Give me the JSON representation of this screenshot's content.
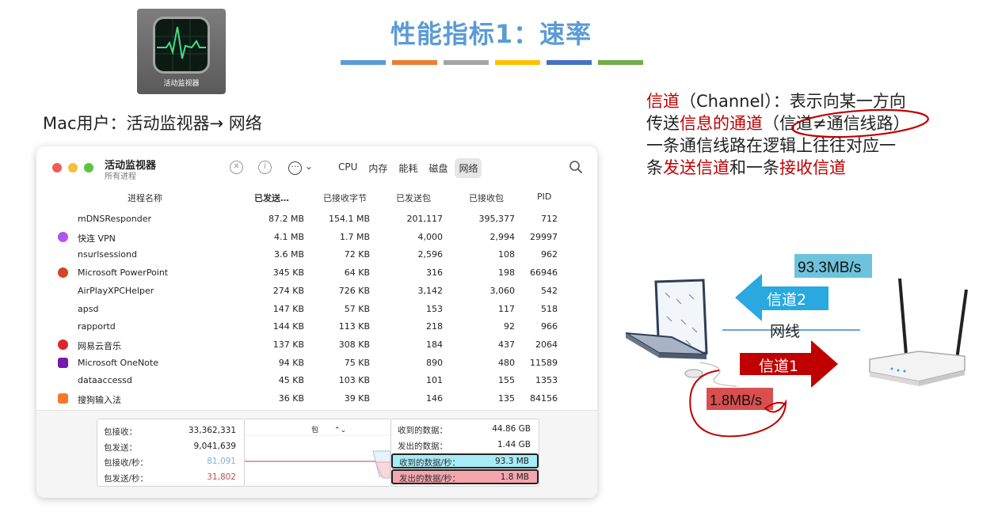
{
  "title": "性能指标1：速率",
  "title_bar_colors": [
    "#5b9bd5",
    "#ed7d31",
    "#a5a5a5",
    "#ffc000",
    "#4472c4",
    "#70ad47"
  ],
  "app_icon_label": "活动监视器",
  "mac_path": "Mac用户：活动监视器→ 网络",
  "window": {
    "title": "活动监视器",
    "subtitle": "所有进程",
    "tabs": [
      "CPU",
      "内存",
      "能耗",
      "磁盘",
      "网络"
    ],
    "active_tab": "网络",
    "columns": [
      "进程名称",
      "已发送…",
      "已接收字节",
      "已发送包",
      "已接收包",
      "PID"
    ],
    "rows": [
      {
        "name": "mDNSResponder",
        "sent": "87.2 MB",
        "recv": "154.1 MB",
        "pkt_sent": "201,117",
        "pkt_recv": "395,377",
        "pid": "712",
        "icon": "none"
      },
      {
        "name": "快连 VPN",
        "sent": "4.1 MB",
        "recv": "1.7 MB",
        "pkt_sent": "4,000",
        "pkt_recv": "2,994",
        "pid": "29997",
        "icon": "vpn-icon"
      },
      {
        "name": "nsurlsessiond",
        "sent": "3.6 MB",
        "recv": "72 KB",
        "pkt_sent": "2,596",
        "pkt_recv": "108",
        "pid": "962",
        "icon": "none"
      },
      {
        "name": "Microsoft PowerPoint",
        "sent": "345 KB",
        "recv": "64 KB",
        "pkt_sent": "316",
        "pkt_recv": "198",
        "pid": "66946",
        "icon": "powerpoint-icon"
      },
      {
        "name": "AirPlayXPCHelper",
        "sent": "274 KB",
        "recv": "726 KB",
        "pkt_sent": "3,142",
        "pkt_recv": "3,060",
        "pid": "542",
        "icon": "none"
      },
      {
        "name": "apsd",
        "sent": "147 KB",
        "recv": "57 KB",
        "pkt_sent": "153",
        "pkt_recv": "117",
        "pid": "518",
        "icon": "none"
      },
      {
        "name": "rapportd",
        "sent": "144 KB",
        "recv": "113 KB",
        "pkt_sent": "218",
        "pkt_recv": "92",
        "pid": "966",
        "icon": "none"
      },
      {
        "name": "网易云音乐",
        "sent": "137 KB",
        "recv": "308 KB",
        "pkt_sent": "184",
        "pkt_recv": "437",
        "pid": "2064",
        "icon": "netease-music-icon"
      },
      {
        "name": "Microsoft OneNote",
        "sent": "94 KB",
        "recv": "75 KB",
        "pkt_sent": "890",
        "pkt_recv": "480",
        "pid": "11589",
        "icon": "onenote-icon"
      },
      {
        "name": "dataaccessd",
        "sent": "45 KB",
        "recv": "103 KB",
        "pkt_sent": "101",
        "pkt_recv": "155",
        "pid": "1353",
        "icon": "none"
      },
      {
        "name": "搜狗输入法",
        "sent": "36 KB",
        "recv": "39 KB",
        "pkt_sent": "146",
        "pkt_recv": "135",
        "pid": "84156",
        "icon": "sogou-icon"
      }
    ],
    "packets": [
      {
        "label": "包接收：",
        "value": "33,362,331"
      },
      {
        "label": "包发送：",
        "value": "9,041,639"
      },
      {
        "label": "包接收/秒：",
        "value": "81,091"
      },
      {
        "label": "包发送/秒：",
        "value": "31,802"
      }
    ],
    "graph_select": "包",
    "data": [
      {
        "label": "收到的数据：",
        "value": "44.86 GB"
      },
      {
        "label": "发出的数据：",
        "value": "1.44 GB"
      },
      {
        "label": "收到的数据/秒：",
        "value": "93.3 MB"
      },
      {
        "label": "发出的数据/秒：",
        "value": "1.8 MB"
      }
    ]
  },
  "channel_desc": {
    "line1_a": "信道",
    "line1_b": "（Channel）：表示向某一方向",
    "line2_a": "传送",
    "line2_b": "信息的通道",
    "line2_c": "（信道≠通信线路）",
    "line3": "一条通信线路在逻辑上往往对应一",
    "line4_a": "条",
    "line4_b": "发送信道",
    "line4_c": "和一条",
    "line4_d": "接收信道"
  },
  "illustration": {
    "speed_top": "93.3MB/s",
    "channel2": "信道2",
    "wire": "网线",
    "channel1": "信道1",
    "speed_bottom": "1.8MB/s"
  }
}
